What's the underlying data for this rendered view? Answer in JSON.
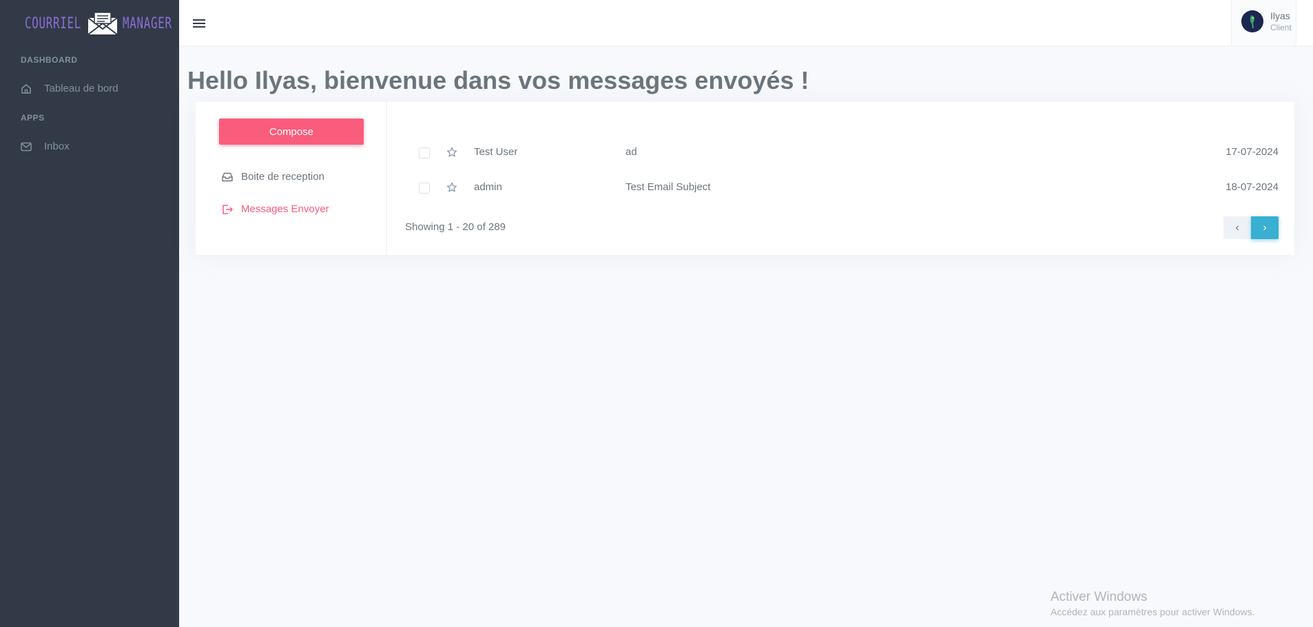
{
  "logo": {
    "word1": "COURRIEL",
    "word2": "MANAGER",
    "icon": "envelope-letter-icon"
  },
  "sidebar": {
    "sections": [
      {
        "title": "DASHBOARD",
        "items": [
          {
            "label": "Tableau de bord",
            "icon": "home-icon"
          }
        ]
      },
      {
        "title": "APPS",
        "items": [
          {
            "label": "Inbox",
            "icon": "mail-icon"
          }
        ]
      }
    ]
  },
  "topbar": {
    "menu_icon": "hamburger-menu-icon"
  },
  "user": {
    "name": "Ilyas",
    "role": "Client"
  },
  "page": {
    "title": "Hello Ilyas, bienvenue dans vos messages envoyés !"
  },
  "mailbox": {
    "compose_label": "Compose",
    "folders": [
      {
        "label": "Boite de reception",
        "icon": "inbox-tray-icon",
        "active": false
      },
      {
        "label": "Messages Envoyer",
        "icon": "sent-logout-icon",
        "active": true
      }
    ],
    "messages": [
      {
        "from": "Test User",
        "subject": "ad",
        "date": "17-07-2024",
        "checked": false,
        "starred": false
      },
      {
        "from": "admin",
        "subject": "Test Email Subject",
        "date": "18-07-2024",
        "checked": false,
        "starred": false
      }
    ],
    "pagination": {
      "showing": "Showing 1 - 20 of 289",
      "prev": "‹",
      "next": "›"
    }
  },
  "colors": {
    "sidebar_bg": "#313a46",
    "accent_pink": "#fa5c7c",
    "accent_cyan": "#39afd1",
    "logo_purple": "#8c6dd6"
  },
  "watermark": {
    "line1": "Activer Windows",
    "line2": "Accédez aux paramètres pour activer Windows."
  }
}
